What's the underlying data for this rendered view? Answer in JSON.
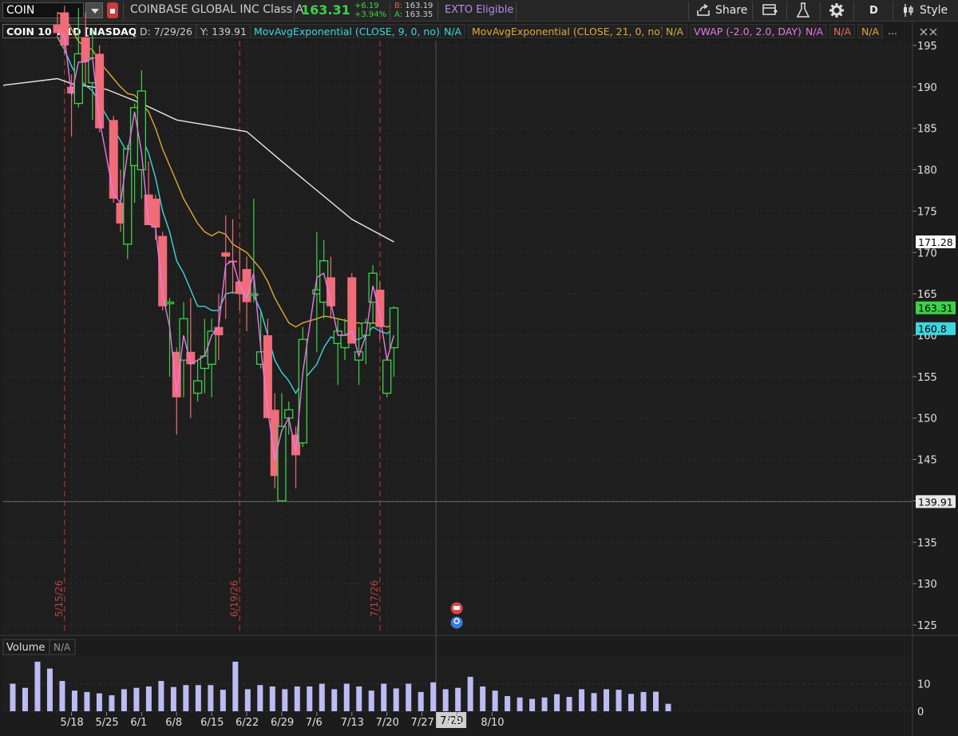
{
  "toolbar": {
    "symbol": "COIN",
    "company": "COINBASE GLOBAL INC Class A",
    "last": "163.31",
    "change": "+6.19",
    "change_pct": "+3.94%",
    "bid_label": "B:",
    "bid": "163.19",
    "ask_label": "A:",
    "ask": "163.35",
    "exto": "EXTO Eligible",
    "share_label": "Share",
    "period_label": "D",
    "style_label": "Style"
  },
  "studies": {
    "title": "COIN 10 Y 1D [NASDAQ]",
    "date": "D: 7/29/26",
    "y": "Y: 139.91",
    "ema9": "MovAvgExponential (CLOSE, 9, 0, no)",
    "ema9_val": "N/A",
    "ema21": "MovAvgExponential (CLOSE, 21, 0, no)",
    "ema21_val": "N/A",
    "vwap": "VWAP (-2.0, 2.0, DAY)",
    "vwap_val": "N/A",
    "vwap_upper": "N/A",
    "vwap_lower": "N/A",
    "more": "..."
  },
  "volume_panel": {
    "title": "Volume",
    "value": "N/A"
  },
  "colors": {
    "up": "#3cd24a",
    "down": "#f06c78",
    "ema9": "#3dd6e0",
    "ema21": "#e0a936",
    "vwap": "#e879e8",
    "sma": "#e8e8e8",
    "volume": "#bcbcf4",
    "event_line": "#b83030"
  },
  "chart_data": {
    "type": "candlestick",
    "price_axis": {
      "min": 125,
      "max": 195,
      "ticks": [
        195,
        190,
        185,
        180,
        175,
        170,
        165,
        160,
        155,
        150,
        145,
        140,
        135,
        130,
        125
      ]
    },
    "price_labels": [
      {
        "value": 171.28,
        "text": "171.28",
        "bg": "#ffffff",
        "fg": "#000000"
      },
      {
        "value": 163.31,
        "text": "163.31",
        "bg": "#3cd24a",
        "fg": "#000000"
      },
      {
        "value": 160.8,
        "text": "160.8",
        "bg": "#3dd6e0",
        "fg": "#000000"
      },
      {
        "value": 139.91,
        "text": "139.91",
        "bg": "#e8e8e8",
        "fg": "#000000"
      }
    ],
    "crosshair_price": 139.91,
    "x_ticks": [
      "5/18",
      "5/25",
      "6/1",
      "6/8",
      "6/15",
      "6/22",
      "6/29",
      "7/6",
      "7/13",
      "7/20",
      "7/27",
      "7/29",
      "8/3",
      "8/10"
    ],
    "event_lines": [
      "5/15/26",
      "6/19/26",
      "7/17/26"
    ],
    "candles": [
      {
        "date": "5/14",
        "o": 197.5,
        "h": 199.0,
        "l": 196.0,
        "c": 196.5
      },
      {
        "date": "5/15",
        "o": 199.0,
        "h": 199.8,
        "l": 194.0,
        "c": 195.0
      },
      {
        "date": "5/18",
        "o": 190.0,
        "h": 191.5,
        "l": 184.0,
        "c": 189.2
      },
      {
        "date": "5/19",
        "o": 188.0,
        "h": 199.5,
        "l": 187.5,
        "c": 194.0
      },
      {
        "date": "5/20",
        "o": 196.0,
        "h": 199.0,
        "l": 190.0,
        "c": 193.0
      },
      {
        "date": "5/21",
        "o": 190.5,
        "h": 197.0,
        "l": 186.0,
        "c": 193.5
      },
      {
        "date": "5/22",
        "o": 194.0,
        "h": 195.0,
        "l": 184.5,
        "c": 185.0
      },
      {
        "date": "5/26",
        "o": 186.0,
        "h": 186.5,
        "l": 176.0,
        "c": 176.5
      },
      {
        "date": "5/27",
        "o": 176.0,
        "h": 180.0,
        "l": 172.5,
        "c": 173.5
      },
      {
        "date": "5/28",
        "o": 171.0,
        "h": 183.0,
        "l": 169.2,
        "c": 182.5
      },
      {
        "date": "5/29",
        "o": 180.5,
        "h": 188.0,
        "l": 176.0,
        "c": 187.5
      },
      {
        "date": "6/1",
        "o": 180.0,
        "h": 192.0,
        "l": 176.5,
        "c": 189.5
      },
      {
        "date": "6/2",
        "o": 177.0,
        "h": 181.0,
        "l": 175.0,
        "c": 173.3
      },
      {
        "date": "6/3",
        "o": 176.5,
        "h": 177.0,
        "l": 171.5,
        "c": 173.0
      },
      {
        "date": "6/4",
        "o": 172.0,
        "h": 172.5,
        "l": 163.0,
        "c": 163.5
      },
      {
        "date": "6/5",
        "o": 164.0,
        "h": 164.5,
        "l": 155.0,
        "c": 164.0
      },
      {
        "date": "6/8",
        "o": 158.0,
        "h": 158.5,
        "l": 148.0,
        "c": 152.5
      },
      {
        "date": "6/9",
        "o": 157.0,
        "h": 164.0,
        "l": 152.5,
        "c": 162.0
      },
      {
        "date": "6/10",
        "o": 158.0,
        "h": 164.5,
        "l": 150.0,
        "c": 156.5
      },
      {
        "date": "6/11",
        "o": 153.0,
        "h": 157.0,
        "l": 152.0,
        "c": 154.5
      },
      {
        "date": "6/12",
        "o": 156.0,
        "h": 162.0,
        "l": 153.0,
        "c": 157.5
      },
      {
        "date": "6/15",
        "o": 156.5,
        "h": 162.0,
        "l": 152.5,
        "c": 160.5
      },
      {
        "date": "6/16",
        "o": 161.0,
        "h": 165.0,
        "l": 157.0,
        "c": 160.0
      },
      {
        "date": "6/17",
        "o": 170.0,
        "h": 174.5,
        "l": 162.0,
        "c": 169.5
      },
      {
        "date": "6/18",
        "o": 169.0,
        "h": 174.0,
        "l": 165.0,
        "c": 168.9
      },
      {
        "date": "6/19",
        "o": 166.5,
        "h": 170.5,
        "l": 163.0,
        "c": 165.0
      },
      {
        "date": "6/22",
        "o": 168.0,
        "h": 169.5,
        "l": 160.5,
        "c": 164.0
      },
      {
        "date": "6/23",
        "o": 165.0,
        "h": 176.5,
        "l": 164.0,
        "c": 165.0
      },
      {
        "date": "6/24",
        "o": 156.5,
        "h": 163.0,
        "l": 156.0,
        "c": 158.0
      },
      {
        "date": "6/25",
        "o": 160.0,
        "h": 162.0,
        "l": 150.0,
        "c": 150.0
      },
      {
        "date": "6/26",
        "o": 151.0,
        "h": 153.0,
        "l": 141.5,
        "c": 143.0
      },
      {
        "date": "6/29",
        "o": 140.0,
        "h": 153.0,
        "l": 140.0,
        "c": 149.0
      },
      {
        "date": "6/30",
        "o": 150.0,
        "h": 152.0,
        "l": 148.0,
        "c": 151.0
      },
      {
        "date": "7/1",
        "o": 148.0,
        "h": 149.0,
        "l": 141.5,
        "c": 145.5
      },
      {
        "date": "7/2",
        "o": 147.0,
        "h": 161.0,
        "l": 146.5,
        "c": 159.5
      },
      {
        "date": "7/6",
        "o": 165.0,
        "h": 172.5,
        "l": 158.0,
        "c": 165.5
      },
      {
        "date": "7/7",
        "o": 164.0,
        "h": 171.5,
        "l": 162.0,
        "c": 169.0
      },
      {
        "date": "7/8",
        "o": 167.0,
        "h": 169.5,
        "l": 162.0,
        "c": 163.5
      },
      {
        "date": "7/9",
        "o": 159.0,
        "h": 162.0,
        "l": 154.0,
        "c": 160.5
      },
      {
        "date": "7/10",
        "o": 158.5,
        "h": 162.0,
        "l": 157.0,
        "c": 160.0
      },
      {
        "date": "7/13",
        "o": 167.0,
        "h": 167.5,
        "l": 159.0,
        "c": 159.0
      },
      {
        "date": "7/14",
        "o": 157.0,
        "h": 161.0,
        "l": 154.0,
        "c": 158.0
      },
      {
        "date": "7/15",
        "o": 160.0,
        "h": 162.0,
        "l": 156.5,
        "c": 161.5
      },
      {
        "date": "7/16",
        "o": 164.0,
        "h": 168.5,
        "l": 161.5,
        "c": 167.5
      },
      {
        "date": "7/17",
        "o": 165.5,
        "h": 166.5,
        "l": 159.5,
        "c": 161.0
      },
      {
        "date": "7/20",
        "o": 153.0,
        "h": 157.0,
        "l": 152.5,
        "c": 157.0
      },
      {
        "date": "7/21",
        "o": 158.5,
        "h": 163.5,
        "l": 155.0,
        "c": 163.3
      }
    ],
    "ema9": [
      196.0,
      194.5,
      192.5,
      191.0,
      190.2,
      189.5,
      188.0,
      185.0,
      183.5,
      182.0,
      182.5,
      184.0,
      182.0,
      179.0,
      175.0,
      172.5,
      169.0,
      167.5,
      165.5,
      163.5,
      163.5,
      163.0,
      163.0,
      165.0,
      165.2,
      165.0,
      165.0,
      164.8,
      163.0,
      160.0,
      157.0,
      155.5,
      154.5,
      153.0,
      154.5,
      156.5,
      158.5,
      159.8,
      159.5,
      159.8,
      159.5,
      159.5,
      160.0,
      161.0,
      160.5,
      160.2,
      160.8
    ],
    "ema21": [
      199.0,
      198.5,
      197.0,
      195.5,
      194.8,
      194.5,
      193.0,
      191.0,
      190.0,
      189.2,
      189.0,
      188.0,
      187.0,
      185.0,
      182.5,
      180.5,
      178.5,
      176.5,
      175.0,
      173.5,
      172.5,
      172.0,
      172.5,
      172.2,
      171.0,
      170.5,
      170.0,
      169.0,
      168.0,
      166.5,
      164.5,
      163.0,
      161.5,
      161.0,
      161.5,
      162.0,
      162.3,
      162.2,
      162.0,
      161.8,
      161.5,
      161.5,
      161.2,
      161.5,
      161.3,
      161.0,
      161.3
    ],
    "vwap": [
      197.0,
      196.0,
      189.0,
      193.0,
      193.0,
      193.5,
      186.0,
      177.0,
      176.0,
      182.0,
      187.0,
      182.0,
      173.5,
      173.0,
      165.0,
      161.0,
      153.0,
      160.0,
      156.5,
      157.0,
      157.5,
      160.0,
      161.0,
      168.5,
      169.0,
      166.0,
      164.5,
      167.5,
      158.5,
      151.0,
      145.0,
      148.5,
      150.0,
      146.0,
      155.5,
      167.0,
      167.5,
      164.0,
      160.0,
      160.0,
      160.5,
      157.5,
      160.0,
      166.0,
      162.5,
      157.0,
      160.0
    ],
    "sma": [
      {
        "date": "5/11",
        "v": 190.2
      },
      {
        "date": "5/14",
        "v": 191.0
      },
      {
        "date": "5/18",
        "v": 190.4
      },
      {
        "date": "5/25",
        "v": 189.7
      },
      {
        "date": "6/1",
        "v": 188.0
      },
      {
        "date": "6/8",
        "v": 186.0
      },
      {
        "date": "6/15",
        "v": 185.3
      },
      {
        "date": "6/22",
        "v": 184.6
      },
      {
        "date": "6/29",
        "v": 181.0
      },
      {
        "date": "7/6",
        "v": 177.5
      },
      {
        "date": "7/13",
        "v": 174.0
      },
      {
        "date": "7/21",
        "v": 171.28
      }
    ],
    "volume": {
      "axis_ticks": [
        10,
        0
      ],
      "values": [
        10.0,
        8.5,
        18.0,
        15.5,
        11.0,
        7.5,
        7.0,
        6.5,
        5.8,
        8.0,
        8.5,
        9.0,
        11.0,
        8.8,
        9.5,
        9.5,
        9.5,
        7.8,
        18.0,
        8.0,
        9.5,
        9.0,
        8.0,
        9.0,
        9.0,
        10.0,
        8.0,
        10.0,
        9.0,
        7.5,
        10.0,
        8.3,
        10.0,
        7.0,
        10.5,
        8.0,
        8.5,
        12.5,
        9.0,
        7.5,
        5.5,
        5.0,
        4.5,
        5.0,
        6.2,
        5.2,
        8.0,
        6.6,
        8.0,
        7.8,
        6.3,
        7.0,
        7.1,
        2.7
      ]
    }
  }
}
